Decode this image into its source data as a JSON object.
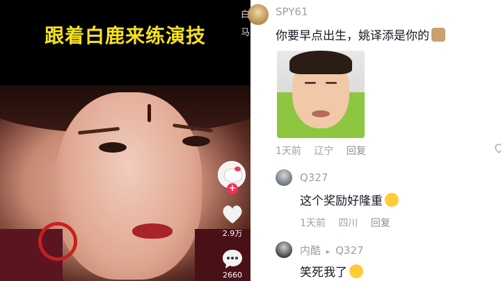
{
  "video": {
    "title": "跟着白鹿来练演技",
    "likes": "2.9万",
    "comments": "2660",
    "follow_symbol": "+",
    "strip_chars": [
      "白",
      "马"
    ]
  },
  "comments": [
    {
      "user": "SPY61",
      "text": "你要早点出生，姚译添是你的",
      "time": "1天前",
      "location": "辽宁",
      "reply_label": "回复"
    },
    {
      "user": "Q327",
      "text": "这个奖励好隆重",
      "time": "1天前",
      "location": "四川",
      "reply_label": "回复"
    },
    {
      "user": "内酷",
      "reply_arrow": "▸",
      "reply_to": "Q327",
      "text": "笑死我了"
    }
  ],
  "colors": {
    "title_yellow": "#f6e21c",
    "follow_red": "#fe2c55",
    "meta_gray": "#9aa0a6",
    "text_dark": "#161823"
  }
}
